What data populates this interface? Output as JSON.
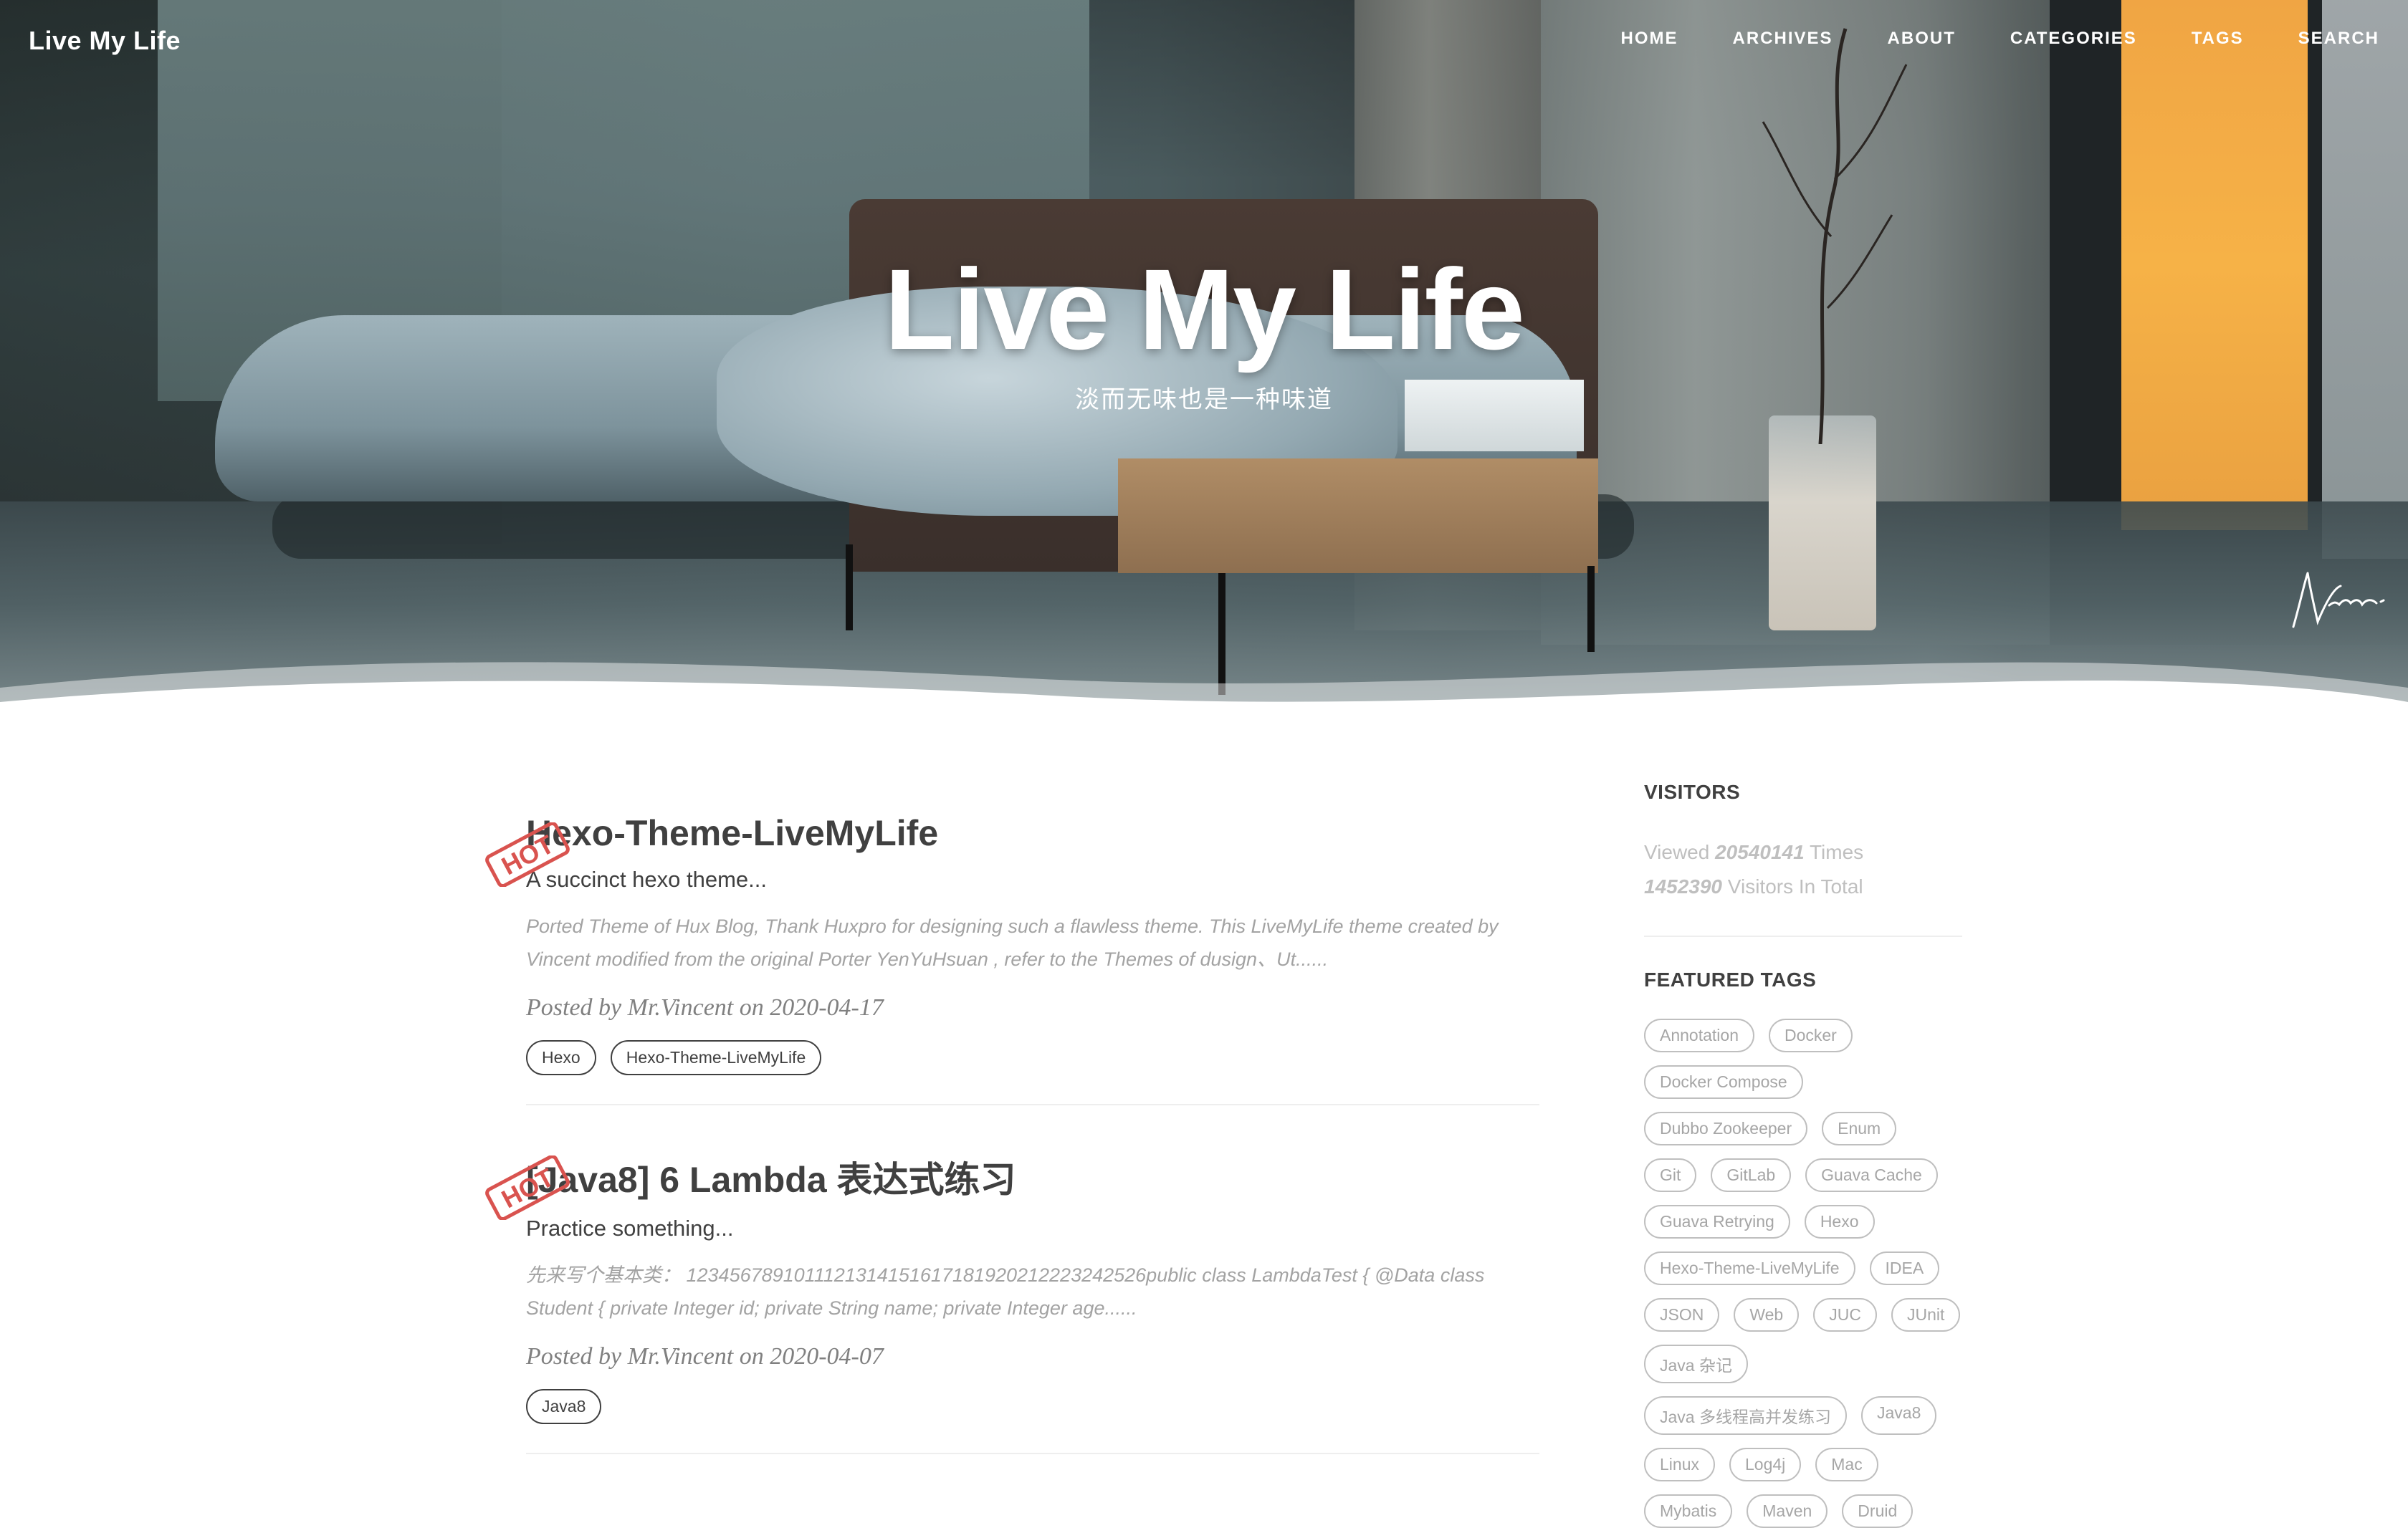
{
  "site": {
    "brand": "Live My Life"
  },
  "nav": {
    "items": [
      "HOME",
      "ARCHIVES",
      "ABOUT",
      "CATEGORIES",
      "TAGS",
      "SEARCH"
    ]
  },
  "hero": {
    "title": "Live My Life",
    "subtitle": "淡而无味也是一种味道",
    "stamp": "HOT"
  },
  "posts": [
    {
      "title": "Hexo-Theme-LiveMyLife",
      "subtitle": "A succinct hexo theme...",
      "excerpt": "Ported Theme of Hux Blog, Thank Huxpro for designing such a flawless theme. This LiveMyLife theme created by Vincent modified from the original Porter YenYuHsuan , refer to the Themes of dusign、Ut......",
      "meta": "Posted by Mr.Vincent on 2020-04-17",
      "tags": [
        "Hexo",
        "Hexo-Theme-LiveMyLife"
      ]
    },
    {
      "title": "[Java8] 6 Lambda 表达式练习",
      "subtitle": "Practice something...",
      "excerpt": "先来写个基本类： 1234567891011121314151617181920212223242526public class LambdaTest { @Data class Student { private Integer id; private String name; private Integer age......",
      "meta": "Posted by Mr.Vincent on 2020-04-07",
      "tags": [
        "Java8"
      ]
    }
  ],
  "sidebar": {
    "visitors_heading": "VISITORS",
    "viewed_prefix": "Viewed",
    "viewed_count": "20540141",
    "viewed_suffix": "Times",
    "visitors_count": "1452390",
    "visitors_suffix": "Visitors In Total",
    "featured_heading": "FEATURED TAGS",
    "tags": [
      "Annotation",
      "Docker",
      "Docker Compose",
      "Dubbo Zookeeper",
      "Enum",
      "Git",
      "GitLab",
      "Guava Cache",
      "Guava Retrying",
      "Hexo",
      "Hexo-Theme-LiveMyLife",
      "IDEA",
      "JSON",
      "Web",
      "JUC",
      "JUnit",
      "Java 杂记",
      "Java 多线程高并发练习",
      "Java8",
      "Linux",
      "Log4j",
      "Mac",
      "Mybatis",
      "Maven",
      "Druid"
    ]
  }
}
